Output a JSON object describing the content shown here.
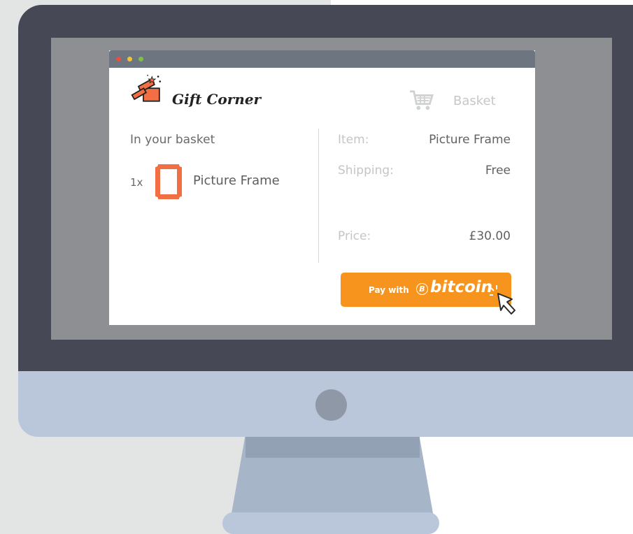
{
  "brand": {
    "name": "Gift Corner"
  },
  "header": {
    "basket_label": "Basket"
  },
  "basket": {
    "heading": "In your basket",
    "item": {
      "quantity": "1x",
      "name": "Picture Frame"
    }
  },
  "summary": {
    "item_label": "Item:",
    "item_value": "Picture Frame",
    "shipping_label": "Shipping:",
    "shipping_value": "Free",
    "price_label": "Price:",
    "price_value": "£30.00"
  },
  "payment": {
    "prefix": "Pay with",
    "symbol": "B",
    "brand": "bitcoin"
  },
  "icons": {
    "logo": "gift-box-icon",
    "basket": "shopping-cart-icon",
    "product": "picture-frame-icon",
    "cursor": "hand-pointer-icon",
    "bitcoin": "bitcoin-icon"
  },
  "colors": {
    "accent": "#f7941d",
    "frame": "#f26f44",
    "bezel": "#464855",
    "chin": "#bac6da"
  }
}
